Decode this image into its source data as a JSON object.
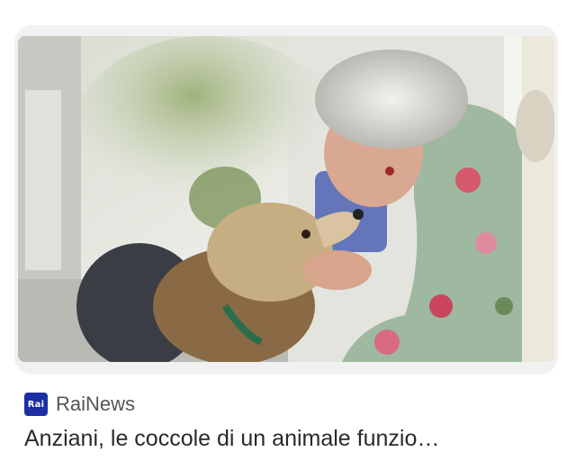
{
  "article": {
    "image_alt": "photo-older-woman-with-dog",
    "source_name": "RaiNews",
    "source_logo_text": "Rai",
    "headline": "Anziani, le coccole di un animale funzio…"
  },
  "colors": {
    "logo_bg": "#1b2fa3",
    "source_text": "#555555",
    "headline_text": "#2a2a2a"
  }
}
